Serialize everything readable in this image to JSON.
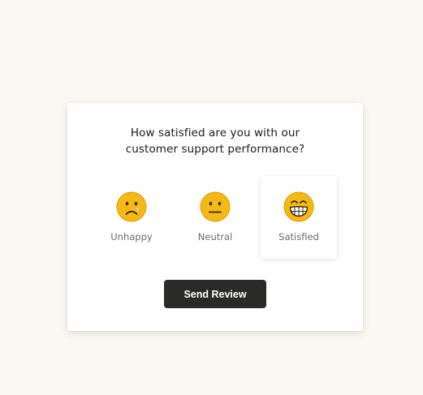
{
  "survey": {
    "question_line1": "How satisfied are you with our",
    "question_line2": "customer support performance?",
    "options": [
      {
        "label": "Unhappy",
        "icon": "sad-face-icon",
        "selected": false
      },
      {
        "label": "Neutral",
        "icon": "neutral-face-icon",
        "selected": false
      },
      {
        "label": "Satisfied",
        "icon": "grinning-face-icon",
        "selected": true
      }
    ],
    "submit_label": "Send Review"
  },
  "colors": {
    "page_background": "#fbf8f2",
    "card_background": "#ffffff",
    "emoji_yellow": "#f5b913",
    "emoji_outline": "#d99a07",
    "button_background": "#2a2a28",
    "button_text": "#ffffff"
  }
}
